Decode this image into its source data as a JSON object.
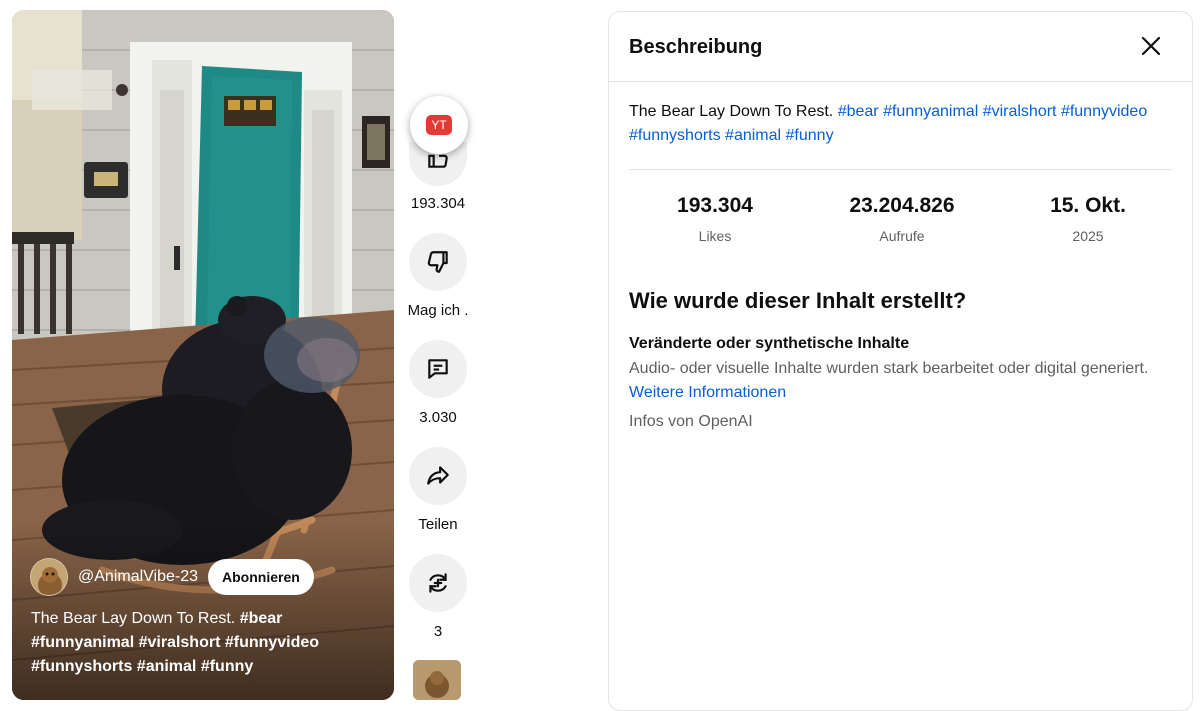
{
  "video": {
    "channel_name": "@AnimalVibe-23",
    "subscribe_label": "Abonnieren",
    "caption_title": "The Bear Lay Down To Rest.",
    "caption_tags_line1": "#bear",
    "caption_tags_line2": "#funnyanimal #viralshort #funnyvideo",
    "caption_tags_line3": "#funnyshorts #animal #funny"
  },
  "actions": {
    "badge_label": "YT",
    "like_count": "193.304",
    "dislike_label": "Mag ich .",
    "comment_count": "3.030",
    "share_label": "Teilen",
    "remix_count": "3"
  },
  "panel": {
    "title": "Beschreibung",
    "description_text": "The Bear Lay Down To Rest.",
    "description_tags": "#bear #funnyanimal #viralshort #funnyvideo #funnyshorts #animal #funny",
    "stats": [
      {
        "value": "193.304",
        "label": "Likes"
      },
      {
        "value": "23.204.826",
        "label": "Aufrufe"
      },
      {
        "value": "15. Okt.",
        "label": "2025"
      }
    ],
    "how_made_title": "Wie wurde dieser Inhalt erstellt?",
    "altered_title": "Veränderte oder synthetische Inhalte",
    "altered_text": "Audio- oder visuelle Inhalte wurden stark bearbeitet oder digital generiert.",
    "more_info_link": "Weitere Informationen",
    "info_source": "Infos von OpenAI"
  },
  "colors": {
    "link_blue": "#065fd4",
    "door_teal": "#1f8a85",
    "badge_red": "#e53935"
  },
  "icons": [
    "thumbs-down-icon",
    "comment-icon",
    "share-icon",
    "remix-icon",
    "close-icon"
  ]
}
